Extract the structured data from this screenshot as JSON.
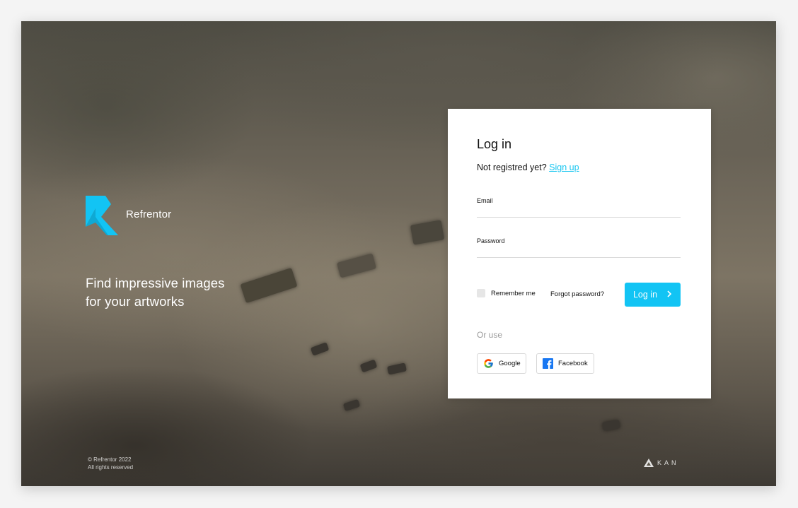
{
  "brand": {
    "name": "Refrentor",
    "accent": "#12c4f4"
  },
  "hero": {
    "tagline_line1": "Find impressive images",
    "tagline_line2": "for your artworks"
  },
  "footer": {
    "copyright": "© Refrentor 2022",
    "rights": "All rights reserved",
    "partner": "KAN"
  },
  "login": {
    "title": "Log in",
    "signup_prompt": "Not registred yet?",
    "signup_link": "Sign up",
    "email_label": "Email",
    "email_value": "",
    "password_label": "Password",
    "password_value": "",
    "remember_label": "Remember me",
    "remember_checked": false,
    "forgot_label": "Forgot password?",
    "submit_label": "Log in",
    "or_use": "Or use",
    "google_label": "Google",
    "facebook_label": "Facebook"
  },
  "icons": {
    "logo": "refrentor-logo-icon",
    "chevron": "chevron-right-icon",
    "google": "google-icon",
    "facebook": "facebook-icon",
    "kan": "kan-logo-icon"
  }
}
